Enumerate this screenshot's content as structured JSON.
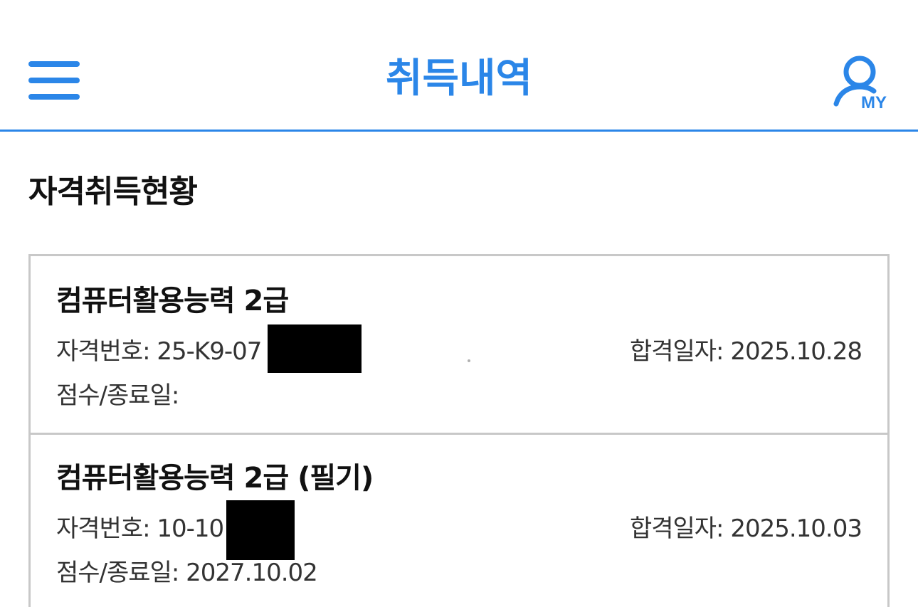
{
  "header": {
    "title": "취득내역",
    "my_label": "MY",
    "accent_color": "#2b86e8",
    "menu_icon": "hamburger-icon",
    "my_icon": "user-icon"
  },
  "section": {
    "title": "자격취득현황"
  },
  "certificates": [
    {
      "name": "컴퓨터활용능력 2급",
      "number_label": "자격번호:",
      "number_value": "25-K9-07",
      "pass_date_label": "합격일자:",
      "pass_date": "2025.10.28",
      "score_label": "점수/종료일:",
      "score_value": ""
    },
    {
      "name": "컴퓨터활용능력 2급 (필기)",
      "number_label": "자격번호:",
      "number_value": "10-10",
      "pass_date_label": "합격일자:",
      "pass_date": "2025.10.03",
      "score_label": "점수/종료일:",
      "score_value": "2027.10.02"
    }
  ]
}
